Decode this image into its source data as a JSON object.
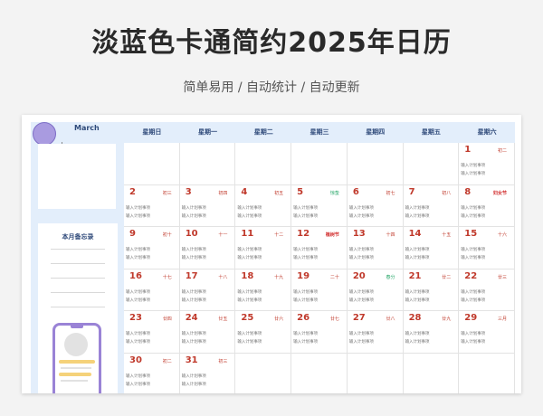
{
  "page": {
    "title": "淡蓝色卡通简约2025年日历",
    "subtitle": "简单易用 / 自动统计 / 自动更新"
  },
  "sidebar": {
    "month": "March",
    "memo_title": "本月备忘录"
  },
  "weekdays": [
    "星期日",
    "星期一",
    "星期二",
    "星期三",
    "星期四",
    "星期五",
    "星期六"
  ],
  "entry_placeholder": "输入计划事项",
  "days": [
    {
      "n": "1",
      "lunar": "初二",
      "kind": "normal"
    },
    {
      "n": "2",
      "lunar": "初三",
      "kind": "normal"
    },
    {
      "n": "3",
      "lunar": "初四",
      "kind": "normal"
    },
    {
      "n": "4",
      "lunar": "初五",
      "kind": "normal"
    },
    {
      "n": "5",
      "lunar": "惊蛰",
      "kind": "term"
    },
    {
      "n": "6",
      "lunar": "初七",
      "kind": "normal"
    },
    {
      "n": "7",
      "lunar": "初八",
      "kind": "normal"
    },
    {
      "n": "8",
      "lunar": "妇女节",
      "kind": "festival"
    },
    {
      "n": "9",
      "lunar": "初十",
      "kind": "normal"
    },
    {
      "n": "10",
      "lunar": "十一",
      "kind": "normal"
    },
    {
      "n": "11",
      "lunar": "十二",
      "kind": "normal"
    },
    {
      "n": "12",
      "lunar": "植树节",
      "kind": "festival"
    },
    {
      "n": "13",
      "lunar": "十四",
      "kind": "normal"
    },
    {
      "n": "14",
      "lunar": "十五",
      "kind": "normal"
    },
    {
      "n": "15",
      "lunar": "十六",
      "kind": "normal"
    },
    {
      "n": "16",
      "lunar": "十七",
      "kind": "normal"
    },
    {
      "n": "17",
      "lunar": "十八",
      "kind": "normal"
    },
    {
      "n": "18",
      "lunar": "十九",
      "kind": "normal"
    },
    {
      "n": "19",
      "lunar": "二十",
      "kind": "normal"
    },
    {
      "n": "20",
      "lunar": "春分",
      "kind": "term"
    },
    {
      "n": "21",
      "lunar": "廿二",
      "kind": "normal"
    },
    {
      "n": "22",
      "lunar": "廿三",
      "kind": "normal"
    },
    {
      "n": "23",
      "lunar": "廿四",
      "kind": "normal"
    },
    {
      "n": "24",
      "lunar": "廿五",
      "kind": "normal"
    },
    {
      "n": "25",
      "lunar": "廿六",
      "kind": "normal"
    },
    {
      "n": "26",
      "lunar": "廿七",
      "kind": "normal"
    },
    {
      "n": "27",
      "lunar": "廿八",
      "kind": "normal"
    },
    {
      "n": "28",
      "lunar": "廿九",
      "kind": "normal"
    },
    {
      "n": "29",
      "lunar": "三月",
      "kind": "normal"
    },
    {
      "n": "30",
      "lunar": "初二",
      "kind": "normal"
    },
    {
      "n": "31",
      "lunar": "初三",
      "kind": "normal"
    }
  ],
  "first_weekday_index": 6
}
